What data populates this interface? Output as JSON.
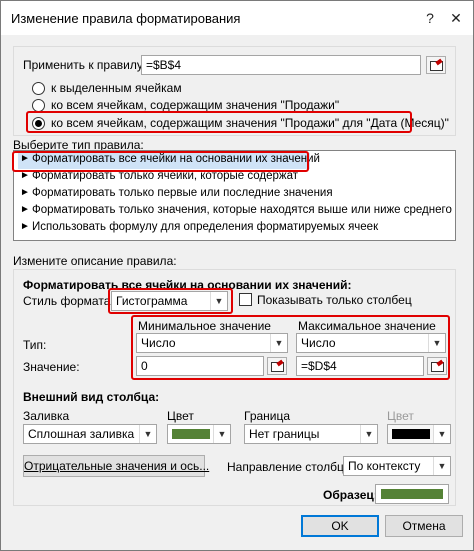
{
  "window": {
    "title": "Изменение правила форматирования",
    "help_glyph": "?",
    "close_glyph": "✕"
  },
  "apply": {
    "label": "Применить к правилу:",
    "value": "=$B$4"
  },
  "scope_radios": [
    {
      "label": "к выделенным ячейкам",
      "selected": false
    },
    {
      "label": "ко всем ячейкам, содержащим значения \"Продажи\"",
      "selected": false
    },
    {
      "label": "ко всем ячейкам, содержащим значения \"Продажи\" для \"Дата (Месяц)\"",
      "selected": true
    }
  ],
  "rule_type": {
    "label": "Выберите тип правила:",
    "items": [
      "Форматировать все ячейки на основании их значений",
      "Форматировать только ячейки, которые содержат",
      "Форматировать только первые или последние значения",
      "Форматировать только значения, которые находятся выше или ниже среднего",
      "Использовать формулу для определения форматируемых ячеек"
    ],
    "arrow": "►"
  },
  "description": {
    "label": "Измените описание правила:",
    "heading": "Форматировать все ячейки на основании их значений:",
    "style_label": "Стиль формата:",
    "style_value": "Гистограмма",
    "show_bar_only": "Показывать только столбец",
    "min_header": "Минимальное значение",
    "max_header": "Максимальное значение",
    "type_label": "Тип:",
    "value_label": "Значение:",
    "min_type": "Число",
    "max_type": "Число",
    "min_value": "0",
    "max_value": "=$D$4"
  },
  "bar_appearance": {
    "heading": "Внешний вид столбца:",
    "fill_label": "Заливка",
    "color_label": "Цвет",
    "border_label": "Граница",
    "border_color_label": "Цвет",
    "fill_value": "Сплошная заливка",
    "fill_color": "#548235",
    "border_value": "Нет границы",
    "border_color": "#000000",
    "negative_button": "Отрицательные значения и ось...",
    "direction_label": "Направление столбца:",
    "direction_value": "По контексту",
    "preview_label": "Образец:",
    "preview_color": "#548235"
  },
  "footer": {
    "ok": "OK",
    "cancel": "Отмена"
  },
  "colors": {
    "highlight": "#e00000",
    "selection": "#cfe3f7"
  }
}
